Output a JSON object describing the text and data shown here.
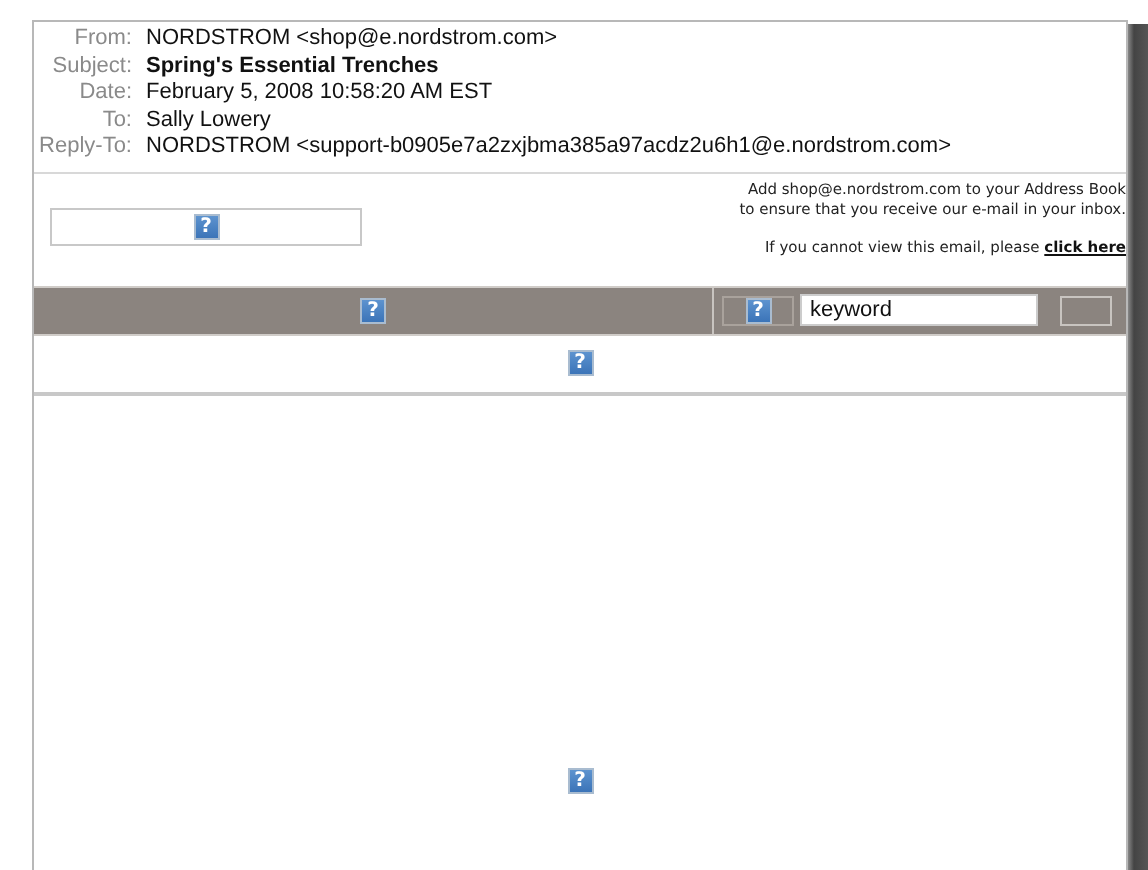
{
  "headers": [
    {
      "label": "From:",
      "value": "NORDSTROM <shop@e.nordstrom.com>",
      "bold": false
    },
    {
      "label": "Subject:",
      "value": "Spring's Essential Trenches",
      "bold": true
    },
    {
      "label": "Date:",
      "value": "February 5, 2008 10:58:20 AM EST",
      "bold": false
    },
    {
      "label": "To:",
      "value": "Sally Lowery",
      "bold": false
    },
    {
      "label": "Reply-To:",
      "value": "NORDSTROM <support-b0905e7a2zxjbma385a97acdz2u6h1@e.nordstrom.com>",
      "bold": false
    }
  ],
  "email": {
    "logo_image": {
      "glyph": "?"
    },
    "notice": [
      "Add shop@e.nordstrom.com to your Address Book",
      "to ensure that you receive our e-mail in your inbox."
    ],
    "view_prompt": "If you cannot view this email, please ",
    "view_link": "click here",
    "banner_image": {
      "glyph": "?"
    },
    "search_image": {
      "glyph": "?"
    },
    "search": {
      "value": "keyword"
    },
    "nav_image": {
      "glyph": "?"
    },
    "hero_image": {
      "glyph": "?"
    }
  }
}
